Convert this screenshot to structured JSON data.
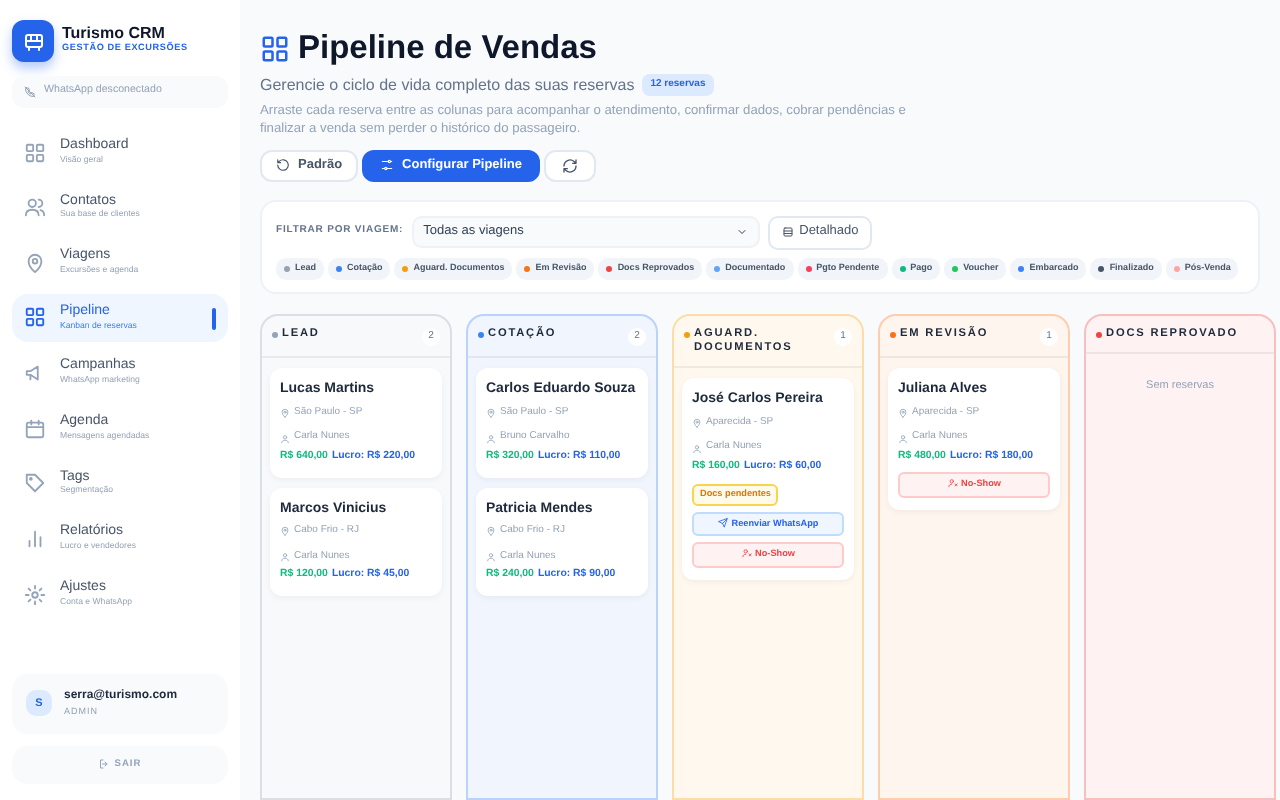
{
  "sidebar": {
    "brand": "Turismo CRM",
    "tagline": "GESTÃO DE EXCURSÕES",
    "whatsapp_status": "WhatsApp desconectado",
    "items": [
      {
        "label": "Dashboard",
        "sub": "Visão geral",
        "selected": false
      },
      {
        "label": "Contatos",
        "sub": "Sua base de clientes",
        "selected": false
      },
      {
        "label": "Viagens",
        "sub": "Excursões e agenda",
        "selected": false
      },
      {
        "label": "Pipeline",
        "sub": "Kanban de reservas",
        "selected": true
      },
      {
        "label": "Campanhas",
        "sub": "WhatsApp marketing",
        "selected": false
      },
      {
        "label": "Agenda",
        "sub": "Mensagens agendadas",
        "selected": false
      },
      {
        "label": "Tags",
        "sub": "Segmentação",
        "selected": false
      },
      {
        "label": "Relatórios",
        "sub": "Lucro e vendedores",
        "selected": false
      },
      {
        "label": "Ajustes",
        "sub": "Conta e WhatsApp",
        "selected": false
      }
    ],
    "user": {
      "avatar": "S",
      "email": "serra@turismo.com",
      "role": "ADMIN"
    },
    "logout": "SAIR"
  },
  "header": {
    "title": "Pipeline de Vendas",
    "subtitle": "Gerencie o ciclo de vida completo das suas reservas",
    "count": "12 reservas",
    "description": "Arraste cada reserva entre as colunas para acompanhar o atendimento, confirmar dados, cobrar pendências e finalizar a venda sem perder o histórico do passageiro.",
    "buttons": [
      {
        "kind": "reset",
        "label": "Padrão"
      },
      {
        "kind": "primary",
        "label": "Configurar Pipeline"
      },
      {
        "kind": "refresh"
      }
    ]
  },
  "filter": {
    "label": "FILTRAR POR VIAGEM:",
    "value": "Todas as viagens",
    "detail": "Detalhado",
    "legend": [
      {
        "label": "Lead",
        "color": "#94a3b8"
      },
      {
        "label": "Cotação",
        "color": "#3b82f6"
      },
      {
        "label": "Aguard. Documentos",
        "color": "#f59e0b"
      },
      {
        "label": "Em Revisão",
        "color": "#f97316"
      },
      {
        "label": "Docs Reprovados",
        "color": "#ef4444"
      },
      {
        "label": "Documentado",
        "color": "#60a5fa"
      },
      {
        "label": "Pgto Pendente",
        "color": "#f43f5e"
      },
      {
        "label": "Pago",
        "color": "#10b981"
      },
      {
        "label": "Voucher",
        "color": "#22c55e"
      },
      {
        "label": "Embarcado",
        "color": "#3b82f6"
      },
      {
        "label": "Finalizado",
        "color": "#475569"
      },
      {
        "label": "Pós-Venda",
        "color": "#fca5a5"
      }
    ]
  },
  "columns": [
    {
      "name": "LEAD",
      "color": "#94a3b8",
      "count": "2",
      "cards": [
        {
          "name": "Lucas Martins",
          "place": "São Paulo - SP",
          "agent": "Carla Nunes",
          "price": "R$ 640,00",
          "profit": "Lucro: R$ 220,00"
        },
        {
          "name": "Marcos Vinicius",
          "place": "Cabo Frio - RJ",
          "agent": "Carla Nunes",
          "price": "R$ 120,00",
          "profit": "Lucro: R$ 45,00"
        }
      ]
    },
    {
      "name": "COTAÇÃO",
      "color": "#3b82f6",
      "count": "2",
      "cards": [
        {
          "name": "Carlos Eduardo Souza",
          "place": "São Paulo - SP",
          "agent": "Bruno Carvalho",
          "price": "R$ 320,00",
          "profit": "Lucro: R$ 110,00"
        },
        {
          "name": "Patricia Mendes",
          "place": "Cabo Frio - RJ",
          "agent": "Carla Nunes",
          "price": "R$ 240,00",
          "profit": "Lucro: R$ 90,00"
        }
      ]
    },
    {
      "name": "AGUARD. DOCUMENTOS",
      "color": "#f59e0b",
      "count": "1",
      "cards": [
        {
          "name": "José Carlos Pereira",
          "place": "Aparecida - SP",
          "agent": "Carla Nunes",
          "price": "R$ 160,00",
          "profit": "Lucro: R$ 60,00",
          "alert": "Docs pendentes",
          "actions": [
            {
              "kind": "resend",
              "label": "Reenviar WhatsApp"
            },
            {
              "kind": "noshow",
              "label": "No-Show"
            }
          ]
        }
      ]
    },
    {
      "name": "EM REVISÃO",
      "color": "#f97316",
      "count": "1",
      "cards": [
        {
          "name": "Juliana Alves",
          "place": "Aparecida - SP",
          "agent": "Carla Nunes",
          "price": "R$ 480,00",
          "profit": "Lucro: R$ 180,00",
          "actions": [
            {
              "kind": "noshow",
              "label": "No-Show"
            }
          ]
        }
      ]
    },
    {
      "name": "DOCS REPROVADO",
      "color": "#ef4444",
      "empty": "Sem reservas"
    }
  ]
}
